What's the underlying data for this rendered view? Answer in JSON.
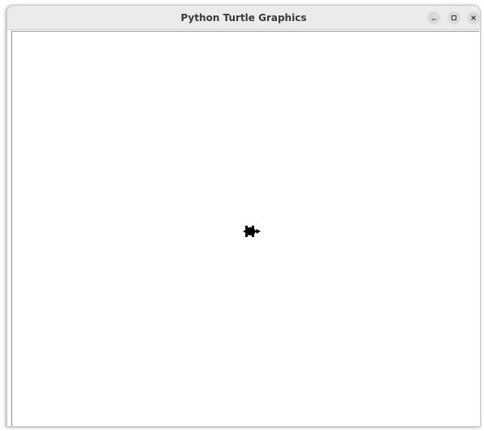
{
  "window": {
    "title": "Python Turtle Graphics",
    "controls": [
      "minimize-icon",
      "maximize-icon",
      "close-icon"
    ]
  },
  "canvas": {
    "background": "#ffffff",
    "turtle": {
      "shape": "turtle",
      "color": "#000000",
      "heading": "east"
    }
  }
}
